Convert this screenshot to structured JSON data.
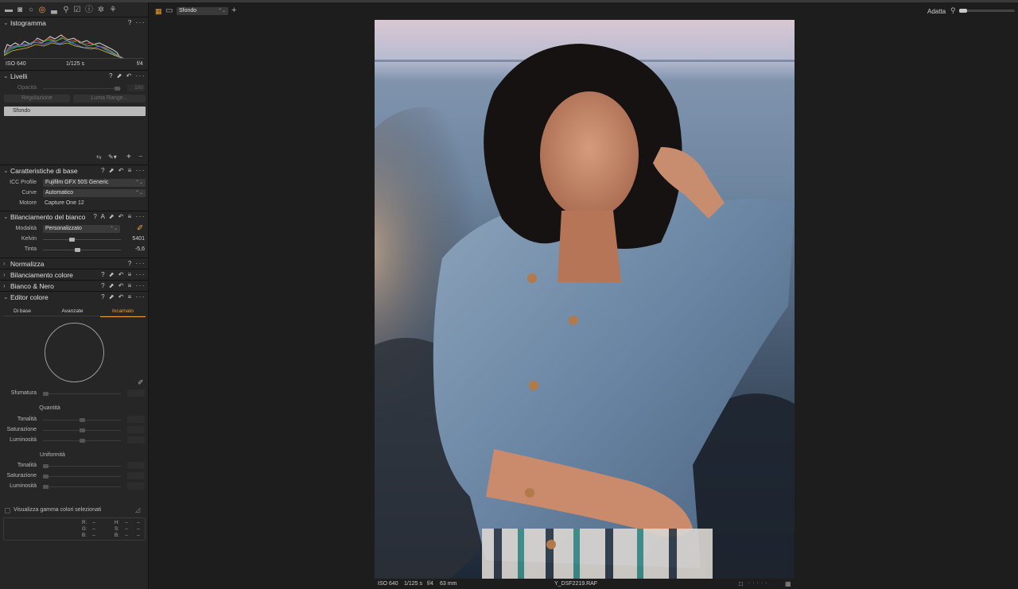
{
  "toolbar": {
    "tool_tabs": [
      "library-icon",
      "capture-icon",
      "lens-icon",
      "color-icon",
      "exposure-icon",
      "details-icon",
      "adjustments-icon",
      "metadata-icon",
      "output-icon",
      "batch-icon"
    ],
    "layer_select": "Sfondo",
    "fit_label": "Adatta"
  },
  "histogram": {
    "title": "Istogramma",
    "iso": "ISO 640",
    "shutter": "1/125 s",
    "aperture": "f/4"
  },
  "levels": {
    "title": "Livelli",
    "opacity_label": "Opacità",
    "opacity_value": "100",
    "regolazione": "Regolazione",
    "luma_range": "Luma Range...",
    "layer_item": "Sfondo"
  },
  "basic": {
    "title": "Caratteristiche di base",
    "icc_label": "ICC Profile",
    "icc_value": "Fujifilm GFX 50S Generic",
    "curve_label": "Curve",
    "curve_value": "Automatico",
    "engine_label": "Motore",
    "engine_value": "Capture One 12"
  },
  "white_balance": {
    "title": "Bilanciamento del bianco",
    "mode_label": "Modalità",
    "mode_value": "Personalizzato",
    "kelvin_label": "Kelvin",
    "kelvin_value": "5401",
    "tint_label": "Tinta",
    "tint_value": "-5,6"
  },
  "collapsed_sections": [
    "Normalizza",
    "Bilanciamento colore",
    "Bianco & Nero"
  ],
  "color_editor": {
    "title": "Editor colore",
    "tabs": [
      "Di base",
      "Avanzate",
      "Incarnato"
    ],
    "active_tab": "Incarnato",
    "smoothness_label": "Sfumatura",
    "amount_heading": "Quantità",
    "uniformity_heading": "Uniformità",
    "hue_label": "Tonalità",
    "saturation_label": "Saturazione",
    "lightness_label": "Luminosità",
    "view_gamut_label": "Visualizza gamma colori selezionati",
    "readout": {
      "r_label": "R:",
      "r_value": "--",
      "g_label": "G:",
      "g_value": "--",
      "b_label": "B:",
      "b_value": "--",
      "h_label": "H:",
      "h_value": "--",
      "s_label": "S:",
      "s_value": "--",
      "b2_label": "B:",
      "b2_value": "--"
    }
  },
  "viewer": {
    "iso": "ISO 640",
    "shutter": "1/125 s",
    "aperture": "f/4",
    "focal": "63 mm",
    "filename": "Y_DSF2219.RAF"
  },
  "colors": {
    "accent": "#f0a030",
    "panel_bg": "#262626",
    "viewer_bg": "#1d1d1d"
  },
  "levels_values": {
    "kelvin_fraction": 0.36,
    "tint_fraction": 0.44
  }
}
